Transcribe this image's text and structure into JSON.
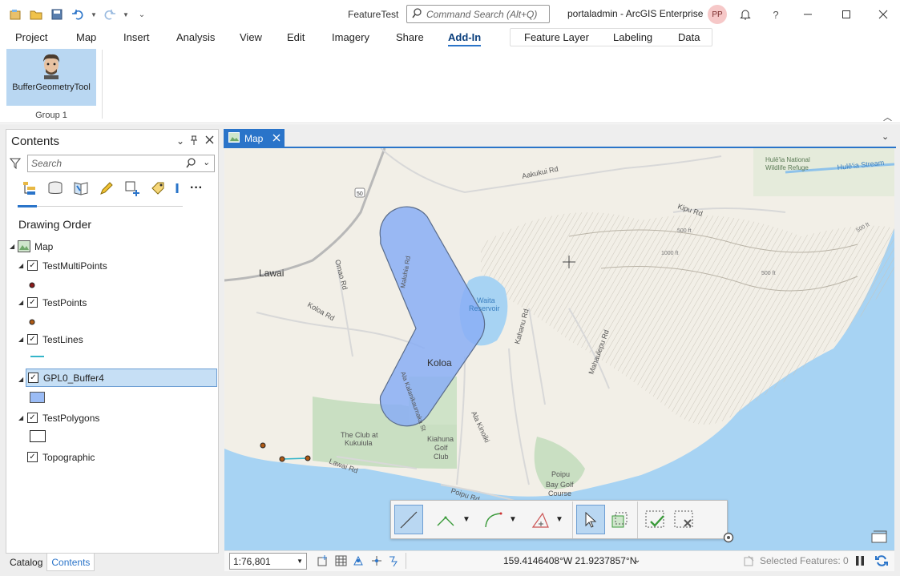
{
  "app": {
    "title": "FeatureTest",
    "search_placeholder": "Command Search (Alt+Q)",
    "portal": "portaladmin - ArcGIS Enterprise",
    "user_initials": "PP"
  },
  "ribbon_tabs": [
    "Project",
    "Map",
    "Insert",
    "Analysis",
    "View",
    "Edit",
    "Imagery",
    "Share",
    "Add-In"
  ],
  "active_tab": "Add-In",
  "context_tabs": [
    "Feature Layer",
    "Labeling",
    "Data"
  ],
  "ribbon": {
    "tool_label": "BufferGeometryTool",
    "group_label": "Group 1"
  },
  "contents": {
    "title": "Contents",
    "search_placeholder": "Search",
    "drawing_order": "Drawing Order",
    "map_name": "Map",
    "layers": [
      {
        "name": "TestMultiPoints",
        "checked": true
      },
      {
        "name": "TestPoints",
        "checked": true
      },
      {
        "name": "TestLines",
        "checked": true
      },
      {
        "name": "GPL0_Buffer4",
        "checked": true,
        "selected": true
      },
      {
        "name": "TestPolygons",
        "checked": true
      },
      {
        "name": "Topographic",
        "checked": true
      }
    ],
    "bottom_tabs": [
      "Catalog",
      "Contents"
    ],
    "active_bottom_tab": "Contents"
  },
  "map": {
    "tab_label": "Map",
    "labels": {
      "lawai": "Lawai",
      "koloa": "Koloa",
      "waita": "Waita",
      "reservoir": "Reservoir",
      "aakukui": "Aakukui Rd",
      "kipu": "Kipu Rd",
      "huleia_refuge_1": "Hulē'ia National",
      "huleia_refuge_2": "Wildlife Refuge",
      "huleia_stream": "Hulē'ia Stream",
      "omao": "Omao Rd",
      "koloa_rd": "Koloa Rd",
      "maluhia": "Maluhia Rd",
      "ala_kalanikaumaka": "Ala Kalanikaumaka St",
      "kahanu": "Kahanu Rd",
      "mahaulepu": "Mahaulepu Rd",
      "ala_kinoiki": "Ala Kinoiki",
      "club1": "The Club at",
      "club2": "Kukuiula",
      "kiahuna1": "Kiahuna",
      "kiahuna2": "Golf",
      "kiahuna3": "Club",
      "poipu1": "Poipu",
      "poipu2": "Bay Golf",
      "poipu3": "Course",
      "lawai_rd": "Lawai Rd",
      "poipu_rd": "Poipu Rd",
      "ft500a": "500 ft",
      "ft1000": "1000 ft",
      "ft500b": "500 ft",
      "ft500c": "500 ft",
      "hwy50": "50"
    }
  },
  "status": {
    "scale": "1:76,801",
    "coordinates": "159.4146408°W 21.9237857°N",
    "selected_features": "Selected Features: 0"
  },
  "colors": {
    "accent": "#2a74c9",
    "buffer_fill": "#8aaef5",
    "buffer_stroke": "#5a6c8a",
    "ocean": "#a7d3f3"
  }
}
